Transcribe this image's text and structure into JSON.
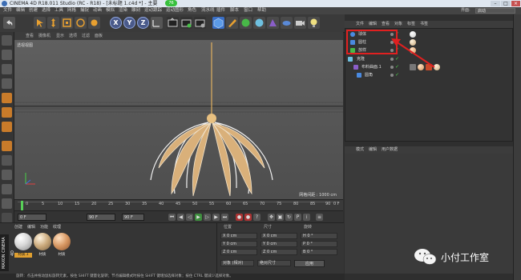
{
  "title": {
    "text": "CINEMA 4D R18.011 Studio (RC - R18) - [未标题 1.c4d *] - 主要",
    "badge": "76",
    "minimize": "–",
    "maximize": "□",
    "close": "×"
  },
  "menubar": {
    "items": [
      "文件",
      "编辑",
      "创建",
      "选择",
      "工具",
      "网格",
      "捕捉",
      "动画",
      "模拟",
      "渲染",
      "雕刻",
      "运动跟踪",
      "运动图形",
      "角色",
      "流水线",
      "插件",
      "脚本",
      "窗口",
      "帮助"
    ],
    "layout_label": "界面:",
    "layout_value": "启动"
  },
  "toolbar": {
    "x_label": "X",
    "y_label": "Y",
    "z_label": "Z"
  },
  "viewport": {
    "menu": [
      "查看",
      "摄像机",
      "显示",
      "选项",
      "过滤",
      "面板"
    ],
    "label": "透视视图",
    "grid_label": "网格间距 : 1000 cm"
  },
  "timeline": {
    "ticks": [
      "0",
      "5",
      "10",
      "15",
      "20",
      "25",
      "30",
      "35",
      "40",
      "45",
      "50",
      "55",
      "60",
      "65",
      "70",
      "75",
      "80",
      "85",
      "90"
    ],
    "current_frame": "0 F",
    "start_field": "0 F",
    "end_field": "90 F",
    "max_field": "90 F"
  },
  "material": {
    "menu": [
      "创建",
      "编辑",
      "功能",
      "纹理"
    ],
    "maxon_label": "MAXON CINEMA 4D",
    "items": [
      {
        "label": "材质.1",
        "color": "#e8e8e8"
      },
      {
        "label": "材质",
        "color": "#c9a87a"
      },
      {
        "label": "材质",
        "color": "#d59560"
      }
    ]
  },
  "coords": {
    "headers": [
      "位置",
      "尺寸",
      "旋转"
    ],
    "pos": [
      "X  0 cm",
      "Y  0 cm",
      "Z  0 cm"
    ],
    "size": [
      "X  0 cm",
      "Y  0 cm",
      "Z  0 cm"
    ],
    "rot": [
      "H  0 °",
      "P  0 °",
      "B  0 °"
    ],
    "mode_a": "对象 (相对)",
    "mode_b": "绝对尺寸",
    "apply": "应用"
  },
  "status": {
    "text": "旋转：点击并拖动鼠标旋转元素，按住 SHIFT 键量化旋转；节点编辑模式时按住 SHIFT 键增加选择对象；按住 CTRL 键减少选择对象。"
  },
  "object_manager": {
    "menu": [
      "文件",
      "编辑",
      "查看",
      "对象",
      "标签",
      "书签"
    ],
    "rows": [
      {
        "label": "球体",
        "indent": 0
      },
      {
        "label": "圆柱",
        "indent": 0
      },
      {
        "label": "放样",
        "indent": 0
      },
      {
        "label": "克隆",
        "indent": 0
      },
      {
        "label": "布料曲面.1",
        "indent": 1
      },
      {
        "label": "圆角",
        "indent": 2
      }
    ]
  },
  "attributes": {
    "menu": [
      "模式",
      "编辑",
      "用户数据"
    ]
  },
  "watermark": {
    "text": "小付工作室"
  }
}
